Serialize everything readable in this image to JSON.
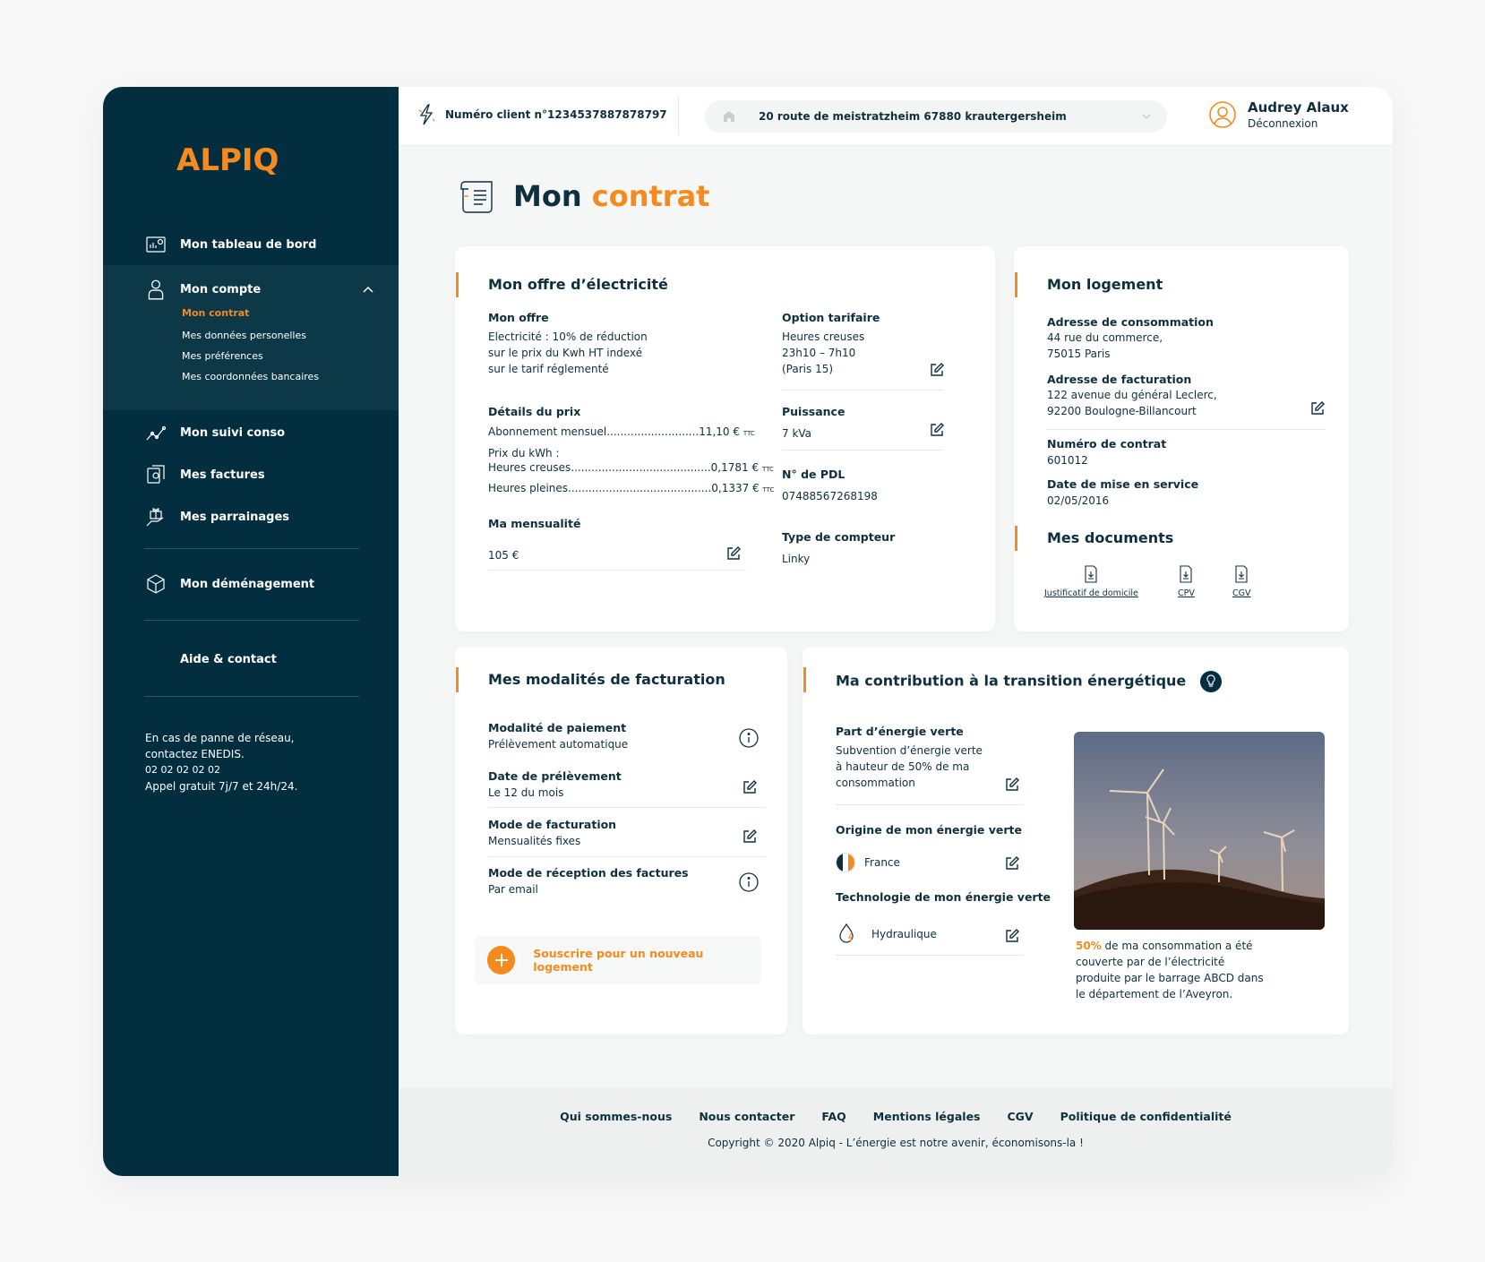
{
  "brand": {
    "logo": "ALPIQ",
    "accent": "#f58a1f",
    "navy": "#032e3f"
  },
  "sidebar": {
    "items": [
      {
        "label": "Mon tableau de bord",
        "icon": "dashboard-icon"
      },
      {
        "label": "Mon compte",
        "icon": "user-icon"
      },
      {
        "label": "Mon suivi conso",
        "icon": "chart-line-icon"
      },
      {
        "label": "Mes factures",
        "icon": "invoice-icon"
      },
      {
        "label": "Mes parrainages",
        "icon": "gift-icon"
      },
      {
        "label": "Mon déménagement",
        "icon": "box-icon"
      },
      {
        "label": "Aide & contact"
      }
    ],
    "account_sub": [
      {
        "label": "Mon contrat",
        "active": true
      },
      {
        "label": "Mes données personelles"
      },
      {
        "label": "Mes préférences"
      },
      {
        "label": "Mes coordonnées bancaires"
      }
    ],
    "help": {
      "line1": "En cas de panne de réseau,",
      "line2": "contactez ENEDIS.",
      "phone": "02 02 02 02 02",
      "line4": "Appel gratuit 7j/7 et 24h/24."
    }
  },
  "topbar": {
    "client_number": "Numéro client n°1234537887878797",
    "address": "20 route de meistratzheim 67880 krautergersheim",
    "user_name": "Audrey Alaux",
    "logout": "Déconnexion"
  },
  "page": {
    "title_a": "Mon",
    "title_b": "contrat"
  },
  "offer": {
    "title": "Mon offre d’électricité",
    "offer_label": "Mon offre",
    "offer_l1": "Electricité : 10% de réduction",
    "offer_l2": "sur le prix du Kwh HT indexé",
    "offer_l3": "sur le tarif réglementé",
    "price_label": "Détails du prix",
    "subscription": "Abonnement mensuel...........................",
    "subscription_val": "11,10 €",
    "kwh_label": "Prix du kWh :",
    "hc": "Heures creuses.........................................",
    "hc_val": "0,1781 €",
    "hp": "Heures pleines..........................................",
    "hp_val": "0,1337 €",
    "ttc": "TTC",
    "monthly_label": "Ma mensualité",
    "monthly_val": "105 €",
    "option_label": "Option tarifaire",
    "option_l1": "Heures creuses",
    "option_l2": "23h10 – 7h10",
    "option_l3": "(Paris 15)",
    "power_label": "Puissance",
    "power_val": "7 kVa",
    "pdl_label": "N° de PDL",
    "pdl_val": "07488567268198",
    "meter_label": "Type de compteur",
    "meter_val": "Linky"
  },
  "housing": {
    "title": "Mon logement",
    "cons_label": "Adresse de consommation",
    "cons_l1": "44 rue du commerce,",
    "cons_l2": "75015 Paris",
    "bill_label": "Adresse de facturation",
    "bill_l1": "122 avenue du général Leclerc,",
    "bill_l2": "92200 Boulogne-Billancourt",
    "contract_label": "Numéro de contrat",
    "contract_val": "601012",
    "date_label": "Date de mise en service",
    "date_val": "02/05/2016",
    "docs_title": "Mes documents",
    "docs": [
      "Justificatif de domicile",
      "CPV",
      "CGV"
    ]
  },
  "billing": {
    "title": "Mes modalités de facturation",
    "pay_label": "Modalité de paiement",
    "pay_val": "Prélèvement automatique",
    "date_label": "Date de prélèvement",
    "date_val": "Le 12 du mois",
    "mode_label": "Mode de facturation",
    "mode_val": "Mensualités fixes",
    "recv_label": "Mode de réception des factures",
    "recv_val": "Par email",
    "subscribe": "Souscrire pour un nouveau logement"
  },
  "contribution": {
    "title": "Ma contribution à la transition énergétique",
    "green_label": "Part d’énergie verte",
    "green_l1": "Subvention d’énergie verte",
    "green_l2": "à hauteur de 50% de ma",
    "green_l3": "consommation",
    "origin_label": "Origine de mon énergie verte",
    "origin_val": "France",
    "tech_label": "Technologie de mon énergie verte",
    "tech_val": "Hydraulique",
    "stat_pct": "50%",
    "stat_l1": " de ma consommation a été",
    "stat_l2": "couverte par de l’électricité",
    "stat_l3": "produite par le barrage ABCD dans",
    "stat_l4": "le département de l’Aveyron."
  },
  "footer": {
    "links": [
      "Qui sommes-nous",
      "Nous contacter",
      "FAQ",
      "Mentions légales",
      "CGV",
      "Politique de confidentialité"
    ],
    "copyright": "Copyright © 2020 Alpiq - L’énergie est notre avenir, économisons-la !"
  }
}
